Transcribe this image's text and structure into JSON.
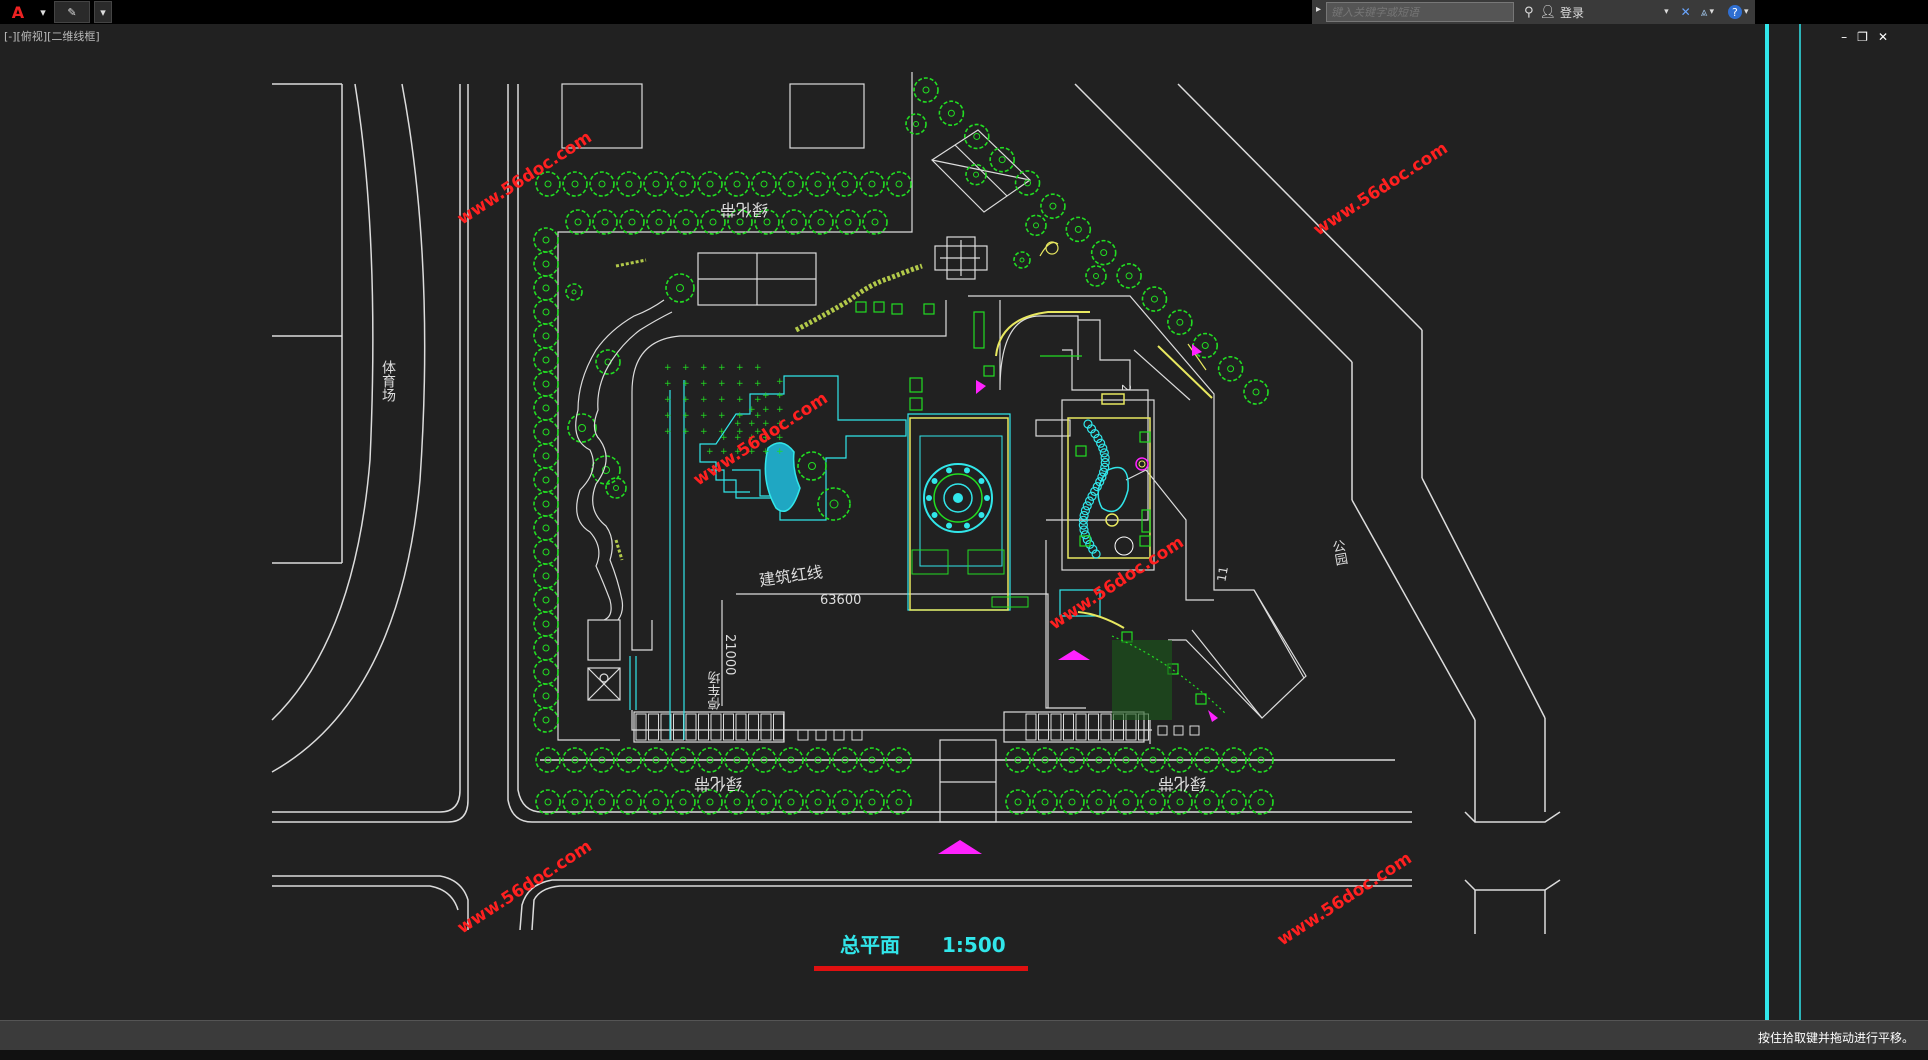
{
  "app": {
    "logo_letter": "A"
  },
  "toolbar": {
    "dropdown_arrow": "▾"
  },
  "search": {
    "placeholder": "键入关键字或短语"
  },
  "account": {
    "login_label": "登录"
  },
  "viewport": {
    "label": "[-][俯视][二维线框]"
  },
  "window_controls": {
    "minimize": "–",
    "restore": "❐",
    "close": "✕"
  },
  "drawing": {
    "title": "总平面",
    "scale": "1:500",
    "labels": {
      "stadium": "体育场",
      "park": "公园",
      "green_belt": "绿化带",
      "red_line": "建筑红线",
      "parking": "停车场",
      "dim_width": "63600",
      "dim_height": "21000",
      "num_2": "2",
      "num_11": "11"
    },
    "watermark": "www.56doc.com"
  },
  "status": {
    "message": "按住拾取键并拖动进行平移。"
  },
  "colors": {
    "accent_cyan": "#31e6ea",
    "tree_green": "#22dd22",
    "magenta": "#ff22ff",
    "watermark_red": "#ff2020",
    "underline_red": "#e01010"
  }
}
